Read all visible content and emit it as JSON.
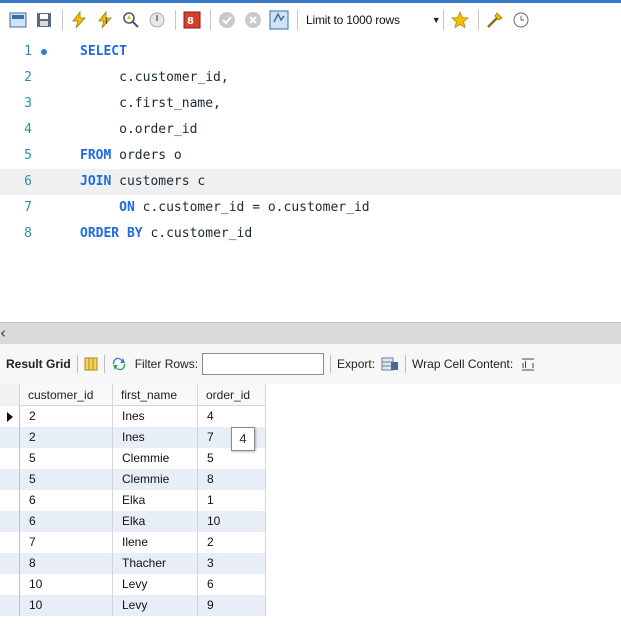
{
  "toolbar": {
    "limit_label": "Limit to 1000 rows",
    "icons": [
      "open-folder-icon",
      "save-icon",
      "execute-icon",
      "execute-current-icon",
      "explain-icon",
      "stop-icon",
      "toggle-error-icon",
      "commit-icon",
      "rollback-icon",
      "autocommit-icon",
      "limit-dropdown",
      "favorite-icon",
      "beautify-icon"
    ]
  },
  "editor": {
    "lines": [
      {
        "num": "1",
        "kw": "SELECT",
        "text": ""
      },
      {
        "num": "2",
        "kw": "",
        "text": "     c.customer_id,"
      },
      {
        "num": "3",
        "kw": "",
        "text": "     c.first_name,"
      },
      {
        "num": "4",
        "kw": "",
        "text": "     o.order_id"
      },
      {
        "num": "5",
        "kw": "FROM",
        "text": " orders o"
      },
      {
        "num": "6",
        "kw": "JOIN",
        "text": " customers c"
      },
      {
        "num": "7",
        "kw": "     ON",
        "text": " c.customer_id = o.customer_id"
      },
      {
        "num": "8",
        "kw": "ORDER BY",
        "text": " c.customer_id"
      }
    ]
  },
  "result_toolbar": {
    "result_grid_label": "Result Grid",
    "filter_label": "Filter Rows:",
    "filter_value": "",
    "export_label": "Export:",
    "wrap_label": "Wrap Cell Content:"
  },
  "grid": {
    "columns": [
      "customer_id",
      "first_name",
      "order_id"
    ],
    "rows": [
      [
        "2",
        "Ines",
        "4"
      ],
      [
        "2",
        "Ines",
        "7"
      ],
      [
        "5",
        "Clemmie",
        "5"
      ],
      [
        "5",
        "Clemmie",
        "8"
      ],
      [
        "6",
        "Elka",
        "1"
      ],
      [
        "6",
        "Elka",
        "10"
      ],
      [
        "7",
        "Ilene",
        "2"
      ],
      [
        "8",
        "Thacher",
        "3"
      ],
      [
        "10",
        "Levy",
        "6"
      ],
      [
        "10",
        "Levy",
        "9"
      ]
    ]
  },
  "tooltip": {
    "text": "4"
  },
  "colors": {
    "keyword": "#1f6ae3",
    "line_number": "#2f8fa0",
    "alt_row": "#e8eef7",
    "accent": "#3a78c7"
  }
}
